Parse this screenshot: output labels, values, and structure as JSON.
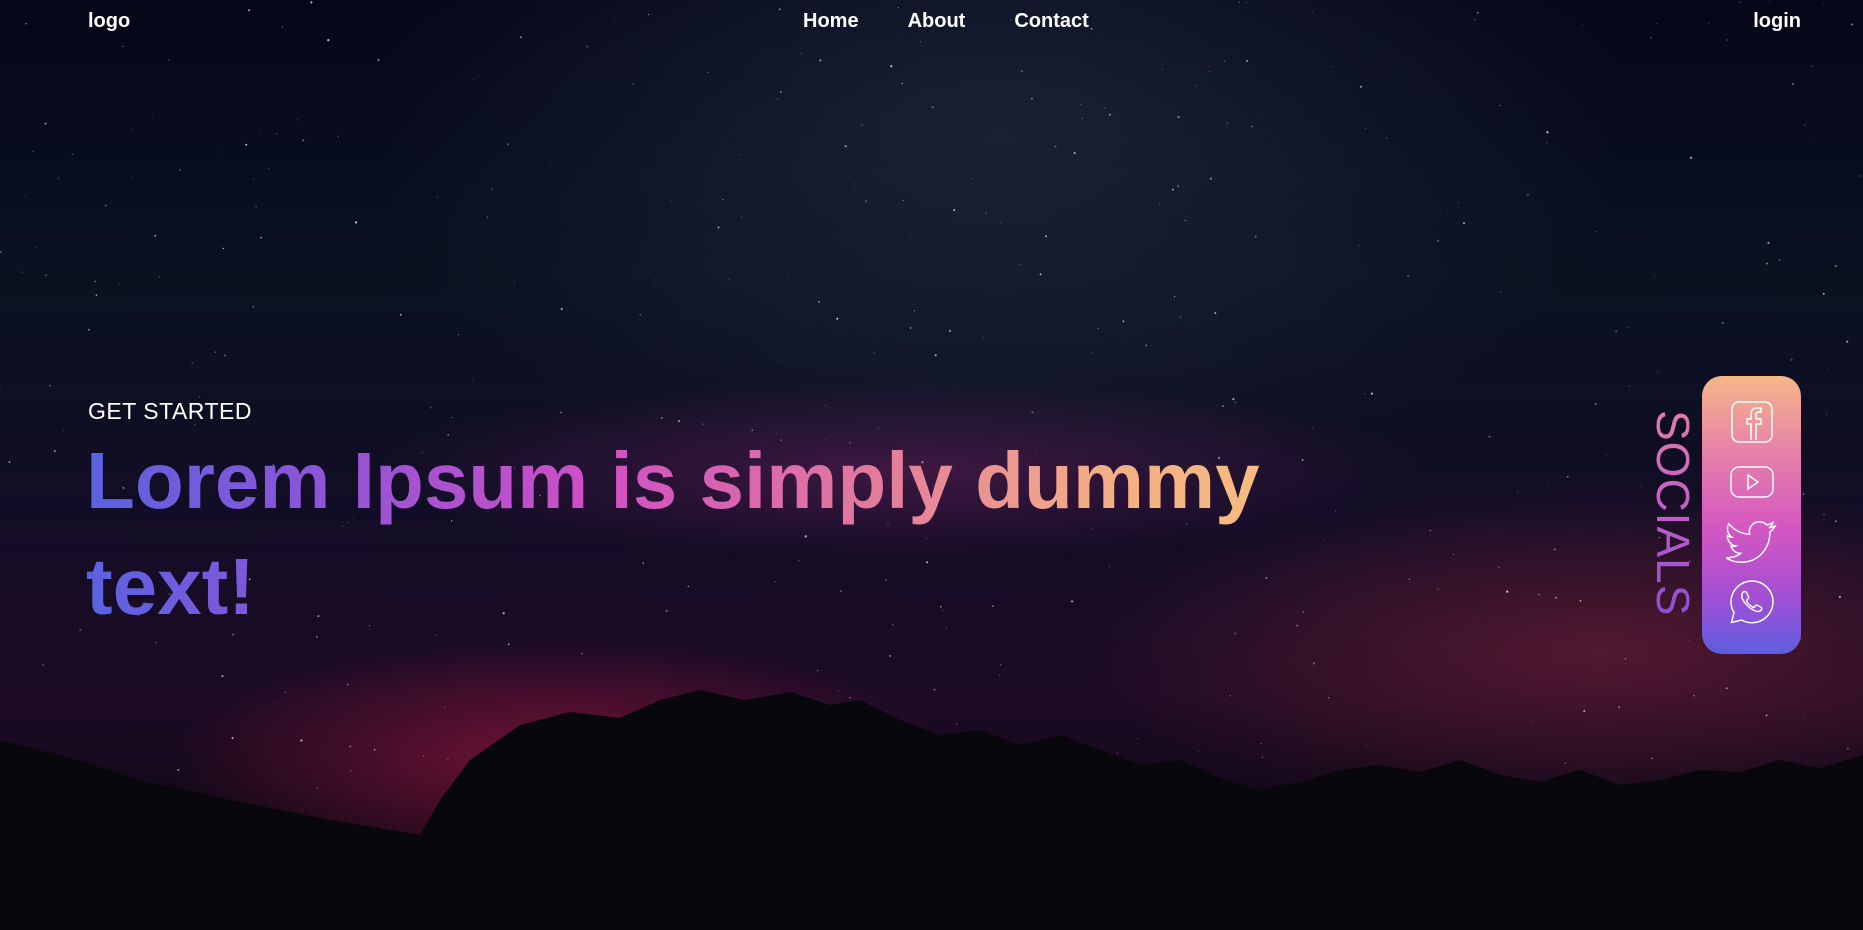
{
  "nav": {
    "logo": "logo",
    "links": [
      {
        "label": "Home"
      },
      {
        "label": "About"
      },
      {
        "label": "Contact"
      }
    ],
    "login": "login"
  },
  "hero": {
    "eyebrow": "GET STARTED",
    "title": "Lorem Ipsum is simply dummy text!"
  },
  "socials": {
    "label": "SOCIALS",
    "icons": [
      "facebook-icon",
      "youtube-icon",
      "twitter-icon",
      "whatsapp-icon"
    ]
  },
  "colors": {
    "gradient_start": "#5a62e0",
    "gradient_mid": "#cf4fc6",
    "gradient_end": "#f7c47e"
  }
}
